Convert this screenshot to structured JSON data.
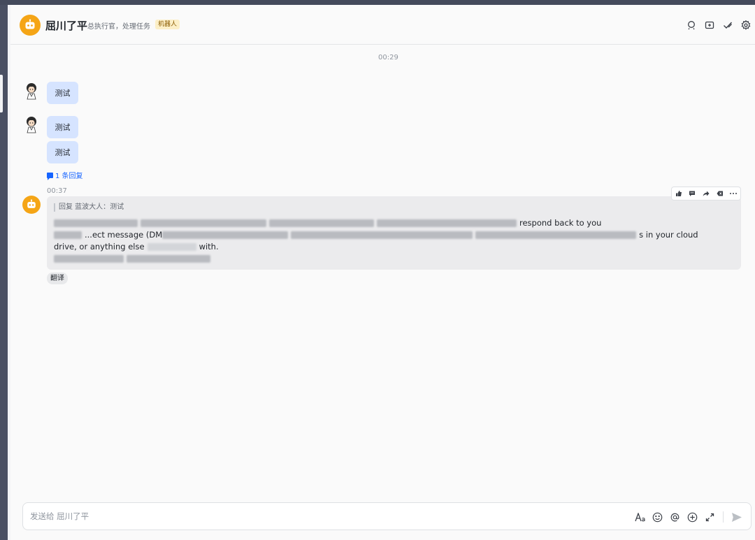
{
  "header": {
    "title": "屈川了平",
    "subtitle": "总执行官，处理任务",
    "badge": "机器人",
    "icons": [
      "search-icon",
      "add-tab-icon",
      "checkmark-icon",
      "settings-icon"
    ]
  },
  "messages": {
    "time_1": "00:29",
    "bubble_1": "测试",
    "bubble_2": "测试",
    "bubble_3": "测试",
    "reply_count": "1 条回复",
    "time_2": "00:37",
    "bot_quote": "回复 蓝波大人：测试",
    "bot_text_fragments": [
      "respond back to you",
      "...ect message (DM",
      "s in your cloud",
      "drive, or anything else",
      "with."
    ],
    "translate_label": "翻译"
  },
  "composer": {
    "placeholder": "发送给 屈川了平",
    "tools": [
      "text-format-icon",
      "emoji-icon",
      "mention-icon",
      "add-icon",
      "expand-icon",
      "send-icon"
    ]
  },
  "colors": {
    "bubble": "#d6e4ff",
    "accent": "#1664ff",
    "bot_avatar": "#f5a516",
    "badge_bg": "#fcefc7"
  }
}
